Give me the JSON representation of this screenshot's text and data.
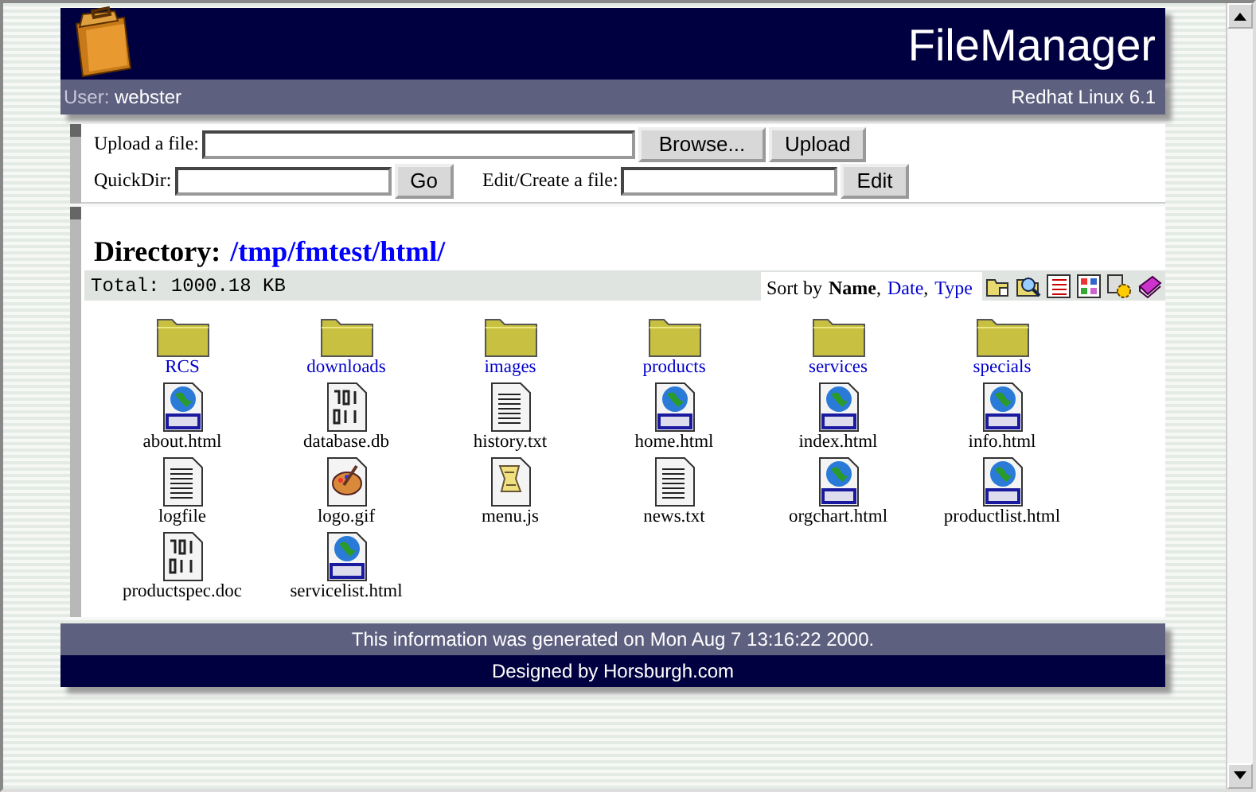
{
  "header": {
    "title": "FileManager",
    "user_label": "User:",
    "user": "webster",
    "system": "Redhat Linux 6.1"
  },
  "upload": {
    "label": "Upload a file:",
    "browse": "Browse...",
    "button": "Upload"
  },
  "quickdir": {
    "label": "QuickDir:",
    "button": "Go"
  },
  "edit": {
    "label": "Edit/Create a file:",
    "button": "Edit"
  },
  "directory": {
    "label": "Directory:",
    "path": "/tmp/fmtest/html/"
  },
  "total": "Total: 1000.18 KB",
  "sort": {
    "label": "Sort by",
    "separator": ",",
    "options": [
      {
        "label": "Name",
        "selected": true
      },
      {
        "label": "Date",
        "selected": false
      },
      {
        "label": "Type",
        "selected": false
      }
    ]
  },
  "files": [
    {
      "name": "RCS",
      "kind": "folder"
    },
    {
      "name": "downloads",
      "kind": "folder"
    },
    {
      "name": "images",
      "kind": "folder"
    },
    {
      "name": "products",
      "kind": "folder"
    },
    {
      "name": "services",
      "kind": "folder"
    },
    {
      "name": "specials",
      "kind": "folder"
    },
    {
      "name": "about.html",
      "kind": "html"
    },
    {
      "name": "database.db",
      "kind": "binary"
    },
    {
      "name": "history.txt",
      "kind": "text"
    },
    {
      "name": "home.html",
      "kind": "html"
    },
    {
      "name": "index.html",
      "kind": "html"
    },
    {
      "name": "info.html",
      "kind": "html"
    },
    {
      "name": "logfile",
      "kind": "text"
    },
    {
      "name": "logo.gif",
      "kind": "image"
    },
    {
      "name": "menu.js",
      "kind": "script"
    },
    {
      "name": "news.txt",
      "kind": "text"
    },
    {
      "name": "orgchart.html",
      "kind": "html"
    },
    {
      "name": "productlist.html",
      "kind": "html"
    },
    {
      "name": "productspec.doc",
      "kind": "binary"
    },
    {
      "name": "servicelist.html",
      "kind": "html"
    }
  ],
  "footer": {
    "generated": "This information was generated on Mon Aug 7 13:16:22 2000.",
    "credit": "Designed by Horsburgh.com"
  }
}
